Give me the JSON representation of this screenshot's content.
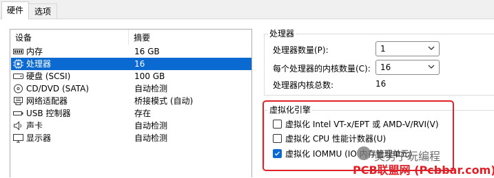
{
  "tabs": [
    {
      "label": "硬件",
      "active": true
    },
    {
      "label": "选项",
      "active": false
    }
  ],
  "device_list": {
    "headers": {
      "device": "设备",
      "summary": "摘要"
    },
    "rows": [
      {
        "name": "内存",
        "summary": "16 GB",
        "icon": "memory-icon",
        "selected": false
      },
      {
        "name": "处理器",
        "summary": "16",
        "icon": "cpu-icon",
        "selected": true
      },
      {
        "name": "硬盘 (SCSI)",
        "summary": "100 GB",
        "icon": "hard-disk-icon",
        "selected": false
      },
      {
        "name": "CD/DVD (SATA)",
        "summary": "自动检测",
        "icon": "cd-dvd-icon",
        "selected": false
      },
      {
        "name": "网络适配器",
        "summary": "桥接模式 (自动)",
        "icon": "network-adapter-icon",
        "selected": false
      },
      {
        "name": "USB 控制器",
        "summary": "存在",
        "icon": "usb-icon",
        "selected": false
      },
      {
        "name": "声卡",
        "summary": "自动检测",
        "icon": "speaker-icon",
        "selected": false
      },
      {
        "name": "显示器",
        "summary": "自动检测",
        "icon": "monitor-icon",
        "selected": false
      }
    ]
  },
  "processor": {
    "group_title": "处理器",
    "count_label": "处理器数量(P):",
    "count_value": "1",
    "cores_label": "每个处理器的内核数量(C):",
    "cores_value": "16",
    "total_label": "处理器内核总数:",
    "total_value": "16"
  },
  "virtualization": {
    "group_title": "虚拟化引擎",
    "options": [
      {
        "label": "虚拟化 Intel VT-x/EPT 或 AMD-V/RVI(V)",
        "checked": false
      },
      {
        "label": "虚拟化 CPU 性能计数器(U)",
        "checked": false
      },
      {
        "label": "虚拟化 IOMMU (IO 内存管理单元)",
        "checked": true
      }
    ]
  },
  "watermark": {
    "line1": "美男子玩编程",
    "line2": "PCB联盟网 (Pcbbar.com)"
  },
  "colors": {
    "selection": "#0a6ad2",
    "highlight_box": "#e01f26"
  }
}
